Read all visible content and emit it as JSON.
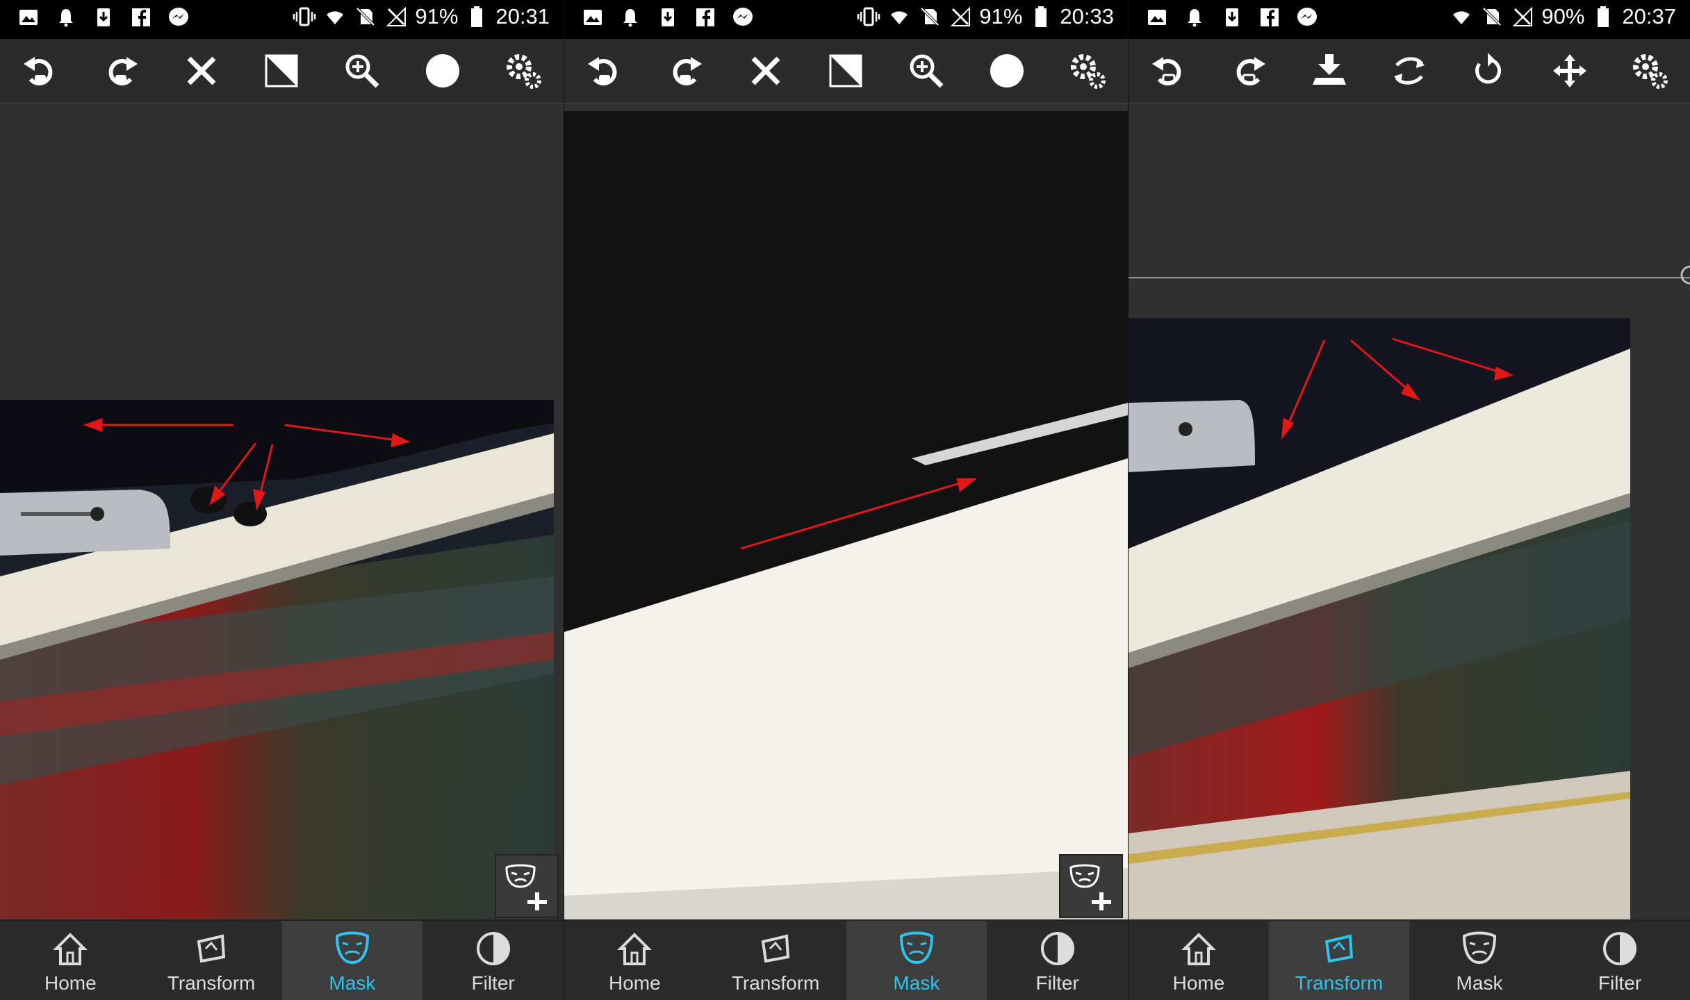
{
  "panels": [
    {
      "status": {
        "battery": "91%",
        "time": "20:31"
      },
      "bottom_nav": [
        {
          "label": "Home",
          "active": false
        },
        {
          "label": "Transform",
          "active": false
        },
        {
          "label": "Mask",
          "active": true
        },
        {
          "label": "Filter",
          "active": false
        }
      ],
      "toolbar_icons": [
        "undo-icon",
        "redo-icon",
        "close-icon",
        "invert-icon",
        "zoom-in-icon",
        "brush-icon",
        "settings-icon"
      ]
    },
    {
      "status": {
        "battery": "91%",
        "time": "20:33"
      },
      "bottom_nav": [
        {
          "label": "Home",
          "active": false
        },
        {
          "label": "Transform",
          "active": false
        },
        {
          "label": "Mask",
          "active": true
        },
        {
          "label": "Filter",
          "active": false
        }
      ],
      "toolbar_icons": [
        "undo-icon",
        "redo-icon",
        "close-icon",
        "invert-icon",
        "zoom-in-icon",
        "brush-icon",
        "settings-icon"
      ]
    },
    {
      "status": {
        "battery": "90%",
        "time": "20:37"
      },
      "bottom_nav": [
        {
          "label": "Home",
          "active": false
        },
        {
          "label": "Transform",
          "active": true
        },
        {
          "label": "Mask",
          "active": false
        },
        {
          "label": "Filter",
          "active": false
        }
      ],
      "toolbar_icons": [
        "undo-icon",
        "redo-icon",
        "import-icon",
        "flip-icon",
        "rotate-icon",
        "move-icon",
        "settings-icon"
      ]
    }
  ],
  "colors": {
    "accent": "#2ec4f0",
    "arrow": "#e01818",
    "bar": "#000000"
  }
}
